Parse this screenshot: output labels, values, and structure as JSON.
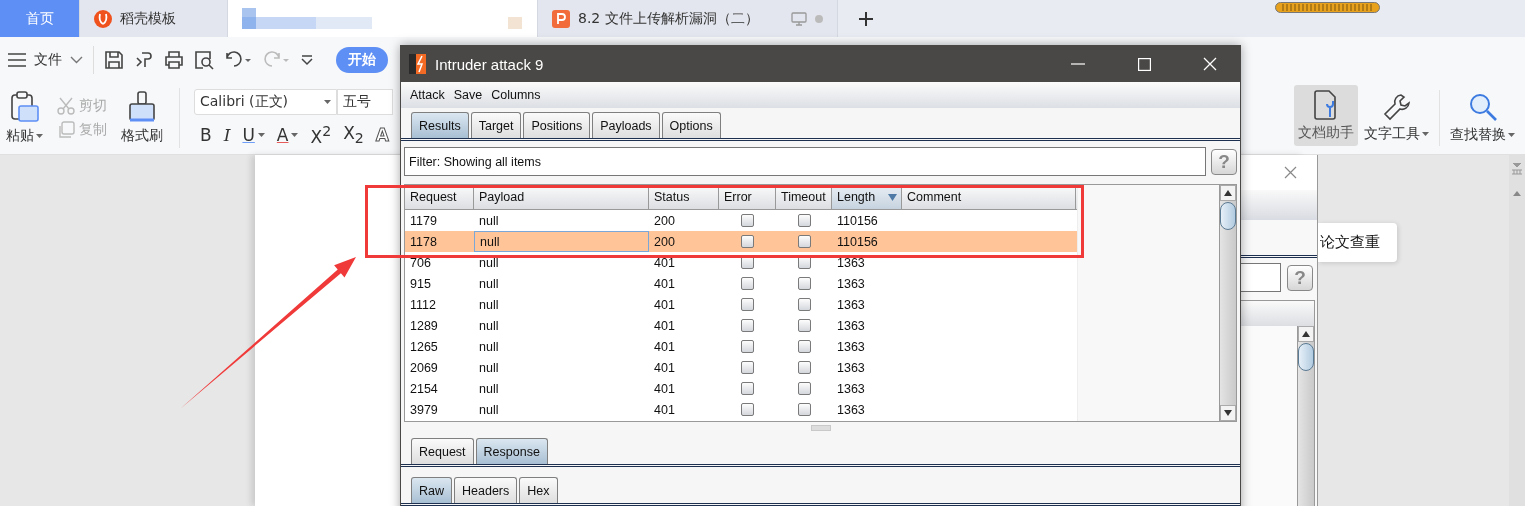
{
  "app_tabs": [
    {
      "kind": "home",
      "label": "首页",
      "selected": false
    },
    {
      "kind": "docer",
      "label": "稻壳模板",
      "selected": false
    },
    {
      "kind": "redacted",
      "selected": true
    },
    {
      "kind": "slides",
      "label": "8.2 文件上传解析漏洞（二）",
      "selected": false
    }
  ],
  "toolbar": {
    "file_menu": "文件",
    "start_button": "开始"
  },
  "ribbon": {
    "paste": "粘贴",
    "clip_buttons": [
      {
        "kind": "cut",
        "label": "剪切",
        "disabled": true
      },
      {
        "kind": "copy",
        "label": "复制",
        "disabled": true
      }
    ],
    "format_painter": "格式刷",
    "font": "Calibri (正文)",
    "size": "五号",
    "format_buttons": [
      {
        "kind": "plain",
        "label": "B"
      },
      {
        "kind": "italic",
        "label": "I"
      },
      {
        "kind": "underline",
        "label": "U"
      },
      {
        "kind": "color",
        "label": "A"
      },
      {
        "kind": "plain",
        "label": "X$^{2}$"
      },
      {
        "kind": "plain",
        "label": "X$_{2}$"
      },
      {
        "kind": "outline",
        "label": "A"
      }
    ],
    "right_tools": [
      {
        "kind": "assistant",
        "label": "文档助手",
        "selected": true,
        "dropdown": false
      },
      {
        "kind": "wrench",
        "label": "文字工具",
        "selected": false,
        "dropdown": true
      },
      {
        "kind": "search",
        "label": "查找替换",
        "selected": false,
        "dropdown": true
      }
    ]
  },
  "popup": {
    "label": "论文查重"
  },
  "back_window": {
    "help": "?"
  },
  "intruder": {
    "title": "Intruder attack 9",
    "menu": [
      "Attack",
      "Save",
      "Columns"
    ],
    "tabs": [
      {
        "label": "Results",
        "selected": true
      },
      {
        "label": "Target",
        "selected": false
      },
      {
        "label": "Positions",
        "selected": false
      },
      {
        "label": "Payloads",
        "selected": false
      },
      {
        "label": "Options",
        "selected": false
      }
    ],
    "filter": "Filter: Showing all items",
    "help": "?",
    "columns": [
      {
        "label": "Request",
        "sorted": false
      },
      {
        "label": "Payload",
        "sorted": false
      },
      {
        "label": "Status",
        "sorted": false
      },
      {
        "label": "Error",
        "sorted": false
      },
      {
        "label": "Timeout",
        "sorted": false
      },
      {
        "label": "Length",
        "sorted": true
      },
      {
        "label": "Comment",
        "sorted": false
      }
    ],
    "rows": [
      {
        "request": "1179",
        "payload": "null",
        "status": "200",
        "error": false,
        "timeout": false,
        "length": "110156",
        "selected": false
      },
      {
        "request": "1178",
        "payload": "null",
        "status": "200",
        "error": false,
        "timeout": false,
        "length": "110156",
        "selected": true
      },
      {
        "request": "706",
        "payload": "null",
        "status": "401",
        "error": false,
        "timeout": false,
        "length": "1363",
        "selected": false
      },
      {
        "request": "915",
        "payload": "null",
        "status": "401",
        "error": false,
        "timeout": false,
        "length": "1363",
        "selected": false
      },
      {
        "request": "1112",
        "payload": "null",
        "status": "401",
        "error": false,
        "timeout": false,
        "length": "1363",
        "selected": false
      },
      {
        "request": "1289",
        "payload": "null",
        "status": "401",
        "error": false,
        "timeout": false,
        "length": "1363",
        "selected": false
      },
      {
        "request": "1265",
        "payload": "null",
        "status": "401",
        "error": false,
        "timeout": false,
        "length": "1363",
        "selected": false
      },
      {
        "request": "2069",
        "payload": "null",
        "status": "401",
        "error": false,
        "timeout": false,
        "length": "1363",
        "selected": false
      },
      {
        "request": "2154",
        "payload": "null",
        "status": "401",
        "error": false,
        "timeout": false,
        "length": "1363",
        "selected": false
      },
      {
        "request": "3979",
        "payload": "null",
        "status": "401",
        "error": false,
        "timeout": false,
        "length": "1363",
        "selected": false
      }
    ],
    "detail_tabs": [
      {
        "label": "Request",
        "selected": false
      },
      {
        "label": "Response",
        "selected": true
      }
    ],
    "view_tabs": [
      {
        "label": "Raw",
        "selected": true
      },
      {
        "label": "Headers",
        "selected": false
      },
      {
        "label": "Hex",
        "selected": false
      }
    ]
  }
}
